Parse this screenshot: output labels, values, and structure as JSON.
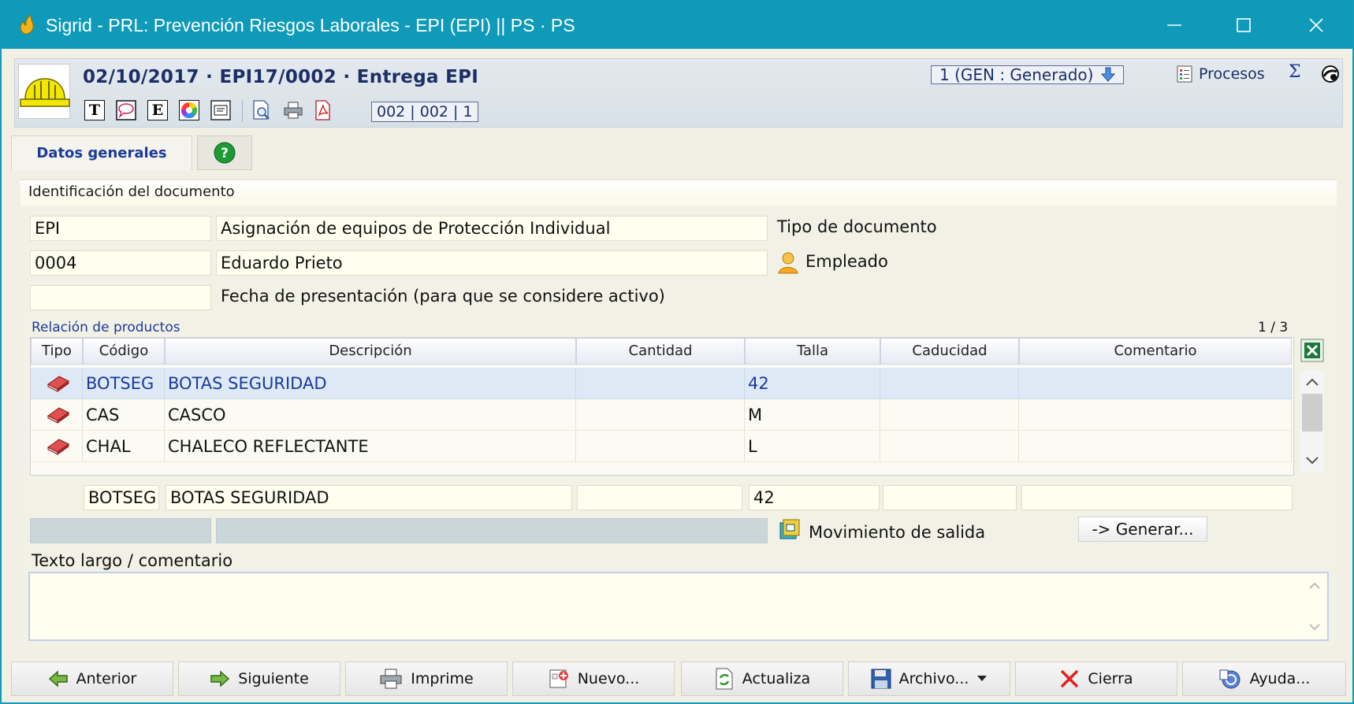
{
  "window": {
    "title": "Sigrid - PRL: Prevención Riesgos Laborales - EPI (EPI) || PS · PS"
  },
  "header": {
    "doc_title": "02/10/2017 · EPI17/0002 · Entrega EPI",
    "counter": "002 | 002 | 1",
    "status": "1 (GEN : Generado)",
    "procesos_label": "Procesos",
    "toolbar_letters": {
      "t": "T",
      "e": "E"
    }
  },
  "tabs": [
    {
      "label": "Datos generales"
    },
    {
      "label": ""
    }
  ],
  "section": {
    "title": "Identificación del documento"
  },
  "form": {
    "doc_type_code": "EPI",
    "doc_type_desc": "Asignación de equipos de Protección Individual",
    "doc_type_label": "Tipo de documento",
    "employee_code": "0004",
    "employee_name": "Eduardo Prieto",
    "employee_label": "Empleado",
    "presentation_date": "",
    "presentation_label": "Fecha de presentación (para que se considere activo)"
  },
  "products": {
    "title": "Relación de productos",
    "pager": "1 / 3",
    "columns": [
      "Tipo",
      "Código",
      "Descripción",
      "Cantidad",
      "Talla",
      "Caducidad",
      "Comentario"
    ],
    "rows": [
      {
        "codigo": "BOTSEG",
        "descripcion": "BOTAS SEGURIDAD",
        "cantidad": "",
        "talla": "42",
        "caducidad": "",
        "comentario": ""
      },
      {
        "codigo": "CAS",
        "descripcion": "CASCO",
        "cantidad": "",
        "talla": "M",
        "caducidad": "",
        "comentario": ""
      },
      {
        "codigo": "CHAL",
        "descripcion": "CHALECO REFLECTANTE",
        "cantidad": "",
        "talla": "L",
        "caducidad": "",
        "comentario": ""
      }
    ],
    "edit_row": {
      "codigo": "BOTSEG",
      "descripcion": "BOTAS SEGURIDAD",
      "cantidad": "",
      "talla": "42",
      "caducidad": "",
      "comentario": ""
    }
  },
  "movement": {
    "label": "Movimiento de salida",
    "generate_button": "-> Generar..."
  },
  "long_text": {
    "label": "Texto largo / comentario",
    "value": ""
  },
  "buttons": {
    "anterior": "Anterior",
    "siguiente": "Siguiente",
    "imprime": "Imprime",
    "nuevo": "Nuevo...",
    "actualiza": "Actualiza",
    "archivo": "Archivo...",
    "cierra": "Cierra",
    "ayuda": "Ayuda..."
  },
  "colors": {
    "titlebar": "#0e9ab8",
    "accent_text": "#1b3a9a",
    "field_bg": "#fffff0",
    "selected_row": "#ddeaf6"
  }
}
